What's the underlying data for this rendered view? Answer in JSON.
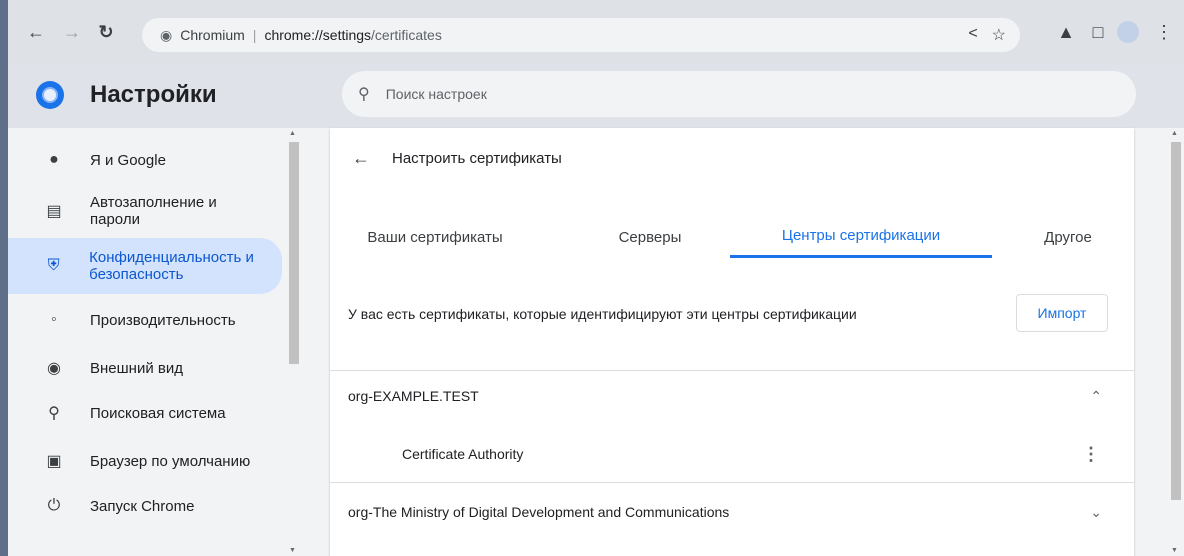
{
  "browser": {
    "site_name": "Chromium",
    "url_host": "chrome://settings",
    "url_path": "/certificates"
  },
  "header": {
    "title": "Настройки",
    "search_placeholder": "Поиск настроек"
  },
  "sidebar": {
    "items": [
      {
        "label": "Я и Google",
        "icon": "person-icon"
      },
      {
        "label": "Автозаполнение и пароли",
        "icon": "clipboard-icon"
      },
      {
        "label": "Конфиденциальность и безопасность",
        "icon": "shield-icon",
        "active": true
      },
      {
        "label": "Производительность",
        "icon": "speedometer-icon"
      },
      {
        "label": "Внешний вид",
        "icon": "palette-icon"
      },
      {
        "label": "Поисковая система",
        "icon": "search-icon"
      },
      {
        "label": "Браузер по умолчанию",
        "icon": "browser-icon"
      },
      {
        "label": "Запуск Chrome",
        "icon": "power-icon"
      }
    ]
  },
  "main": {
    "back_title": "Настроить сертификаты",
    "tabs": [
      {
        "label": "Ваши сертификаты"
      },
      {
        "label": "Серверы"
      },
      {
        "label": "Центры сертификации",
        "active": true
      },
      {
        "label": "Другое"
      }
    ],
    "info_text": "У вас есть сертификаты, которые идентифицируют эти центры сертификации",
    "import_label": "Импорт",
    "orgs": [
      {
        "name": "org-EXAMPLE.TEST",
        "expanded": true,
        "certs": [
          {
            "name": "Certificate Authority"
          }
        ]
      },
      {
        "name": "org-The Ministry of Digital Development and Communications",
        "expanded": false
      }
    ]
  },
  "colors": {
    "accent": "#1a73e8",
    "active_bg": "#d3e3fd"
  }
}
